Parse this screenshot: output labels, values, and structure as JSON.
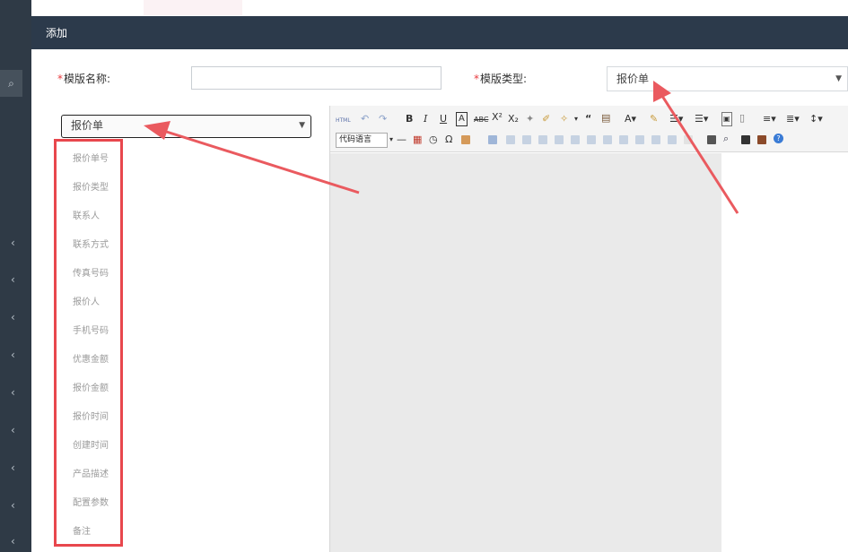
{
  "dialog": {
    "title": "添加"
  },
  "form": {
    "required_mark": "*",
    "name_label": "模版名称:",
    "name_value": "",
    "type_label": "模版类型:",
    "type_value": "报价单"
  },
  "field_select": {
    "value": "报价单"
  },
  "fields": [
    "报价单号",
    "报价类型",
    "联系人",
    "联系方式",
    "传真号码",
    "报价人",
    "手机号码",
    "优惠金额",
    "报价金额",
    "报价时间",
    "创建时间",
    "产品描述",
    "配置参数",
    "备注"
  ],
  "editor": {
    "html_button": "HTML",
    "code_language": "代码语言"
  },
  "icons": {
    "search": "search-icon",
    "sidebar_chevron": "chevron-left-icon",
    "dropdown": "caret-down-icon"
  },
  "colors": {
    "header_bg": "#2c3a4b",
    "sidebar_bg": "#2f3a46",
    "highlight_red": "#e8474d",
    "required_red": "#e8393d"
  }
}
